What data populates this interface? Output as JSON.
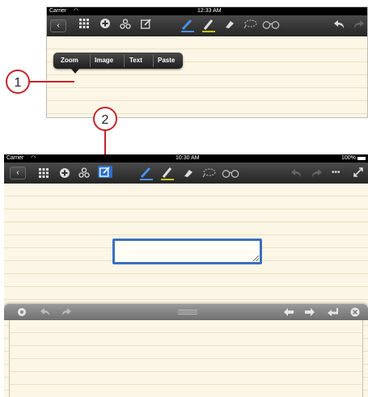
{
  "top": {
    "carrier": "Carrier",
    "time": "12:33 AM",
    "popup_menu": [
      "Zoom",
      "Image",
      "Text",
      "Paste"
    ]
  },
  "bottom": {
    "carrier": "Carrier",
    "time": "10:30 AM",
    "battery": "100%",
    "more_label": "•••"
  },
  "callouts": [
    "1",
    "2"
  ],
  "icons": {
    "back": "back-chevron",
    "grid": "grid-icon",
    "add": "add-icon",
    "group": "group-icon",
    "edit": "edit-text-icon",
    "pen": "pen-icon",
    "highlighter": "highlighter-icon",
    "eraser": "eraser-icon",
    "lasso": "lasso-icon",
    "glasses": "glasses-icon",
    "undo": "undo-icon",
    "redo": "redo-icon",
    "expand": "expand-icon"
  },
  "colors": {
    "accent": "#4a90e2",
    "callout": "#c2262c",
    "paper": "#fbf6e5",
    "highlighter": "#c8c020"
  }
}
